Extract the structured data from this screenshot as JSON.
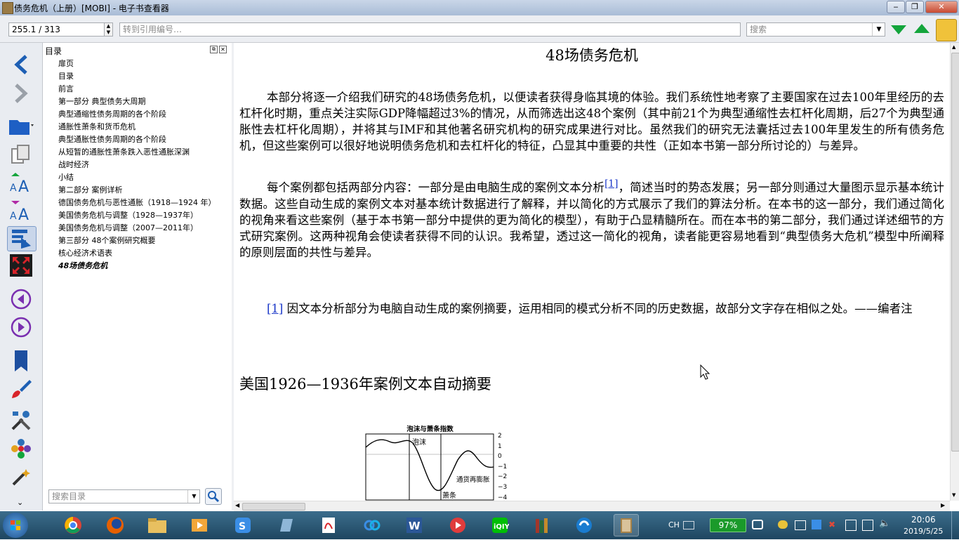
{
  "window": {
    "title": "债务危机（上册）[MOBI] - 电子书查看器"
  },
  "toolbar": {
    "position_value": "255.1 / 313",
    "goto_placeholder": "转到引用编号…",
    "search_placeholder": "搜索"
  },
  "toc": {
    "header": "目录",
    "items": [
      "扉页",
      "目录",
      "前言",
      "第一部分 典型债务大周期",
      "典型通缩性债务周期的各个阶段",
      "通胀性萧条和货币危机",
      "典型通胀性债务周期的各个阶段",
      "从短暂的通胀性萧条跌入恶性通胀深渊",
      "战时经济",
      "小结",
      "第二部分 案例详析",
      "德国债务危机与恶性通胀（1918—1924 年）",
      "美国债务危机与调整（1928—1937年）",
      "美国债务危机与调整（2007—2011年）",
      "第三部分 48个案例研究概要",
      "核心经济术语表",
      "48场债务危机"
    ],
    "search_placeholder": "搜索目录"
  },
  "reader": {
    "chapter_title": "48场债务危机",
    "para1": "本部分将逐一介绍我们研究的48场债务危机，以便读者获得身临其境的体验。我们系统性地考察了主要国家在过去100年里经历的去杠杆化时期，重点关注实际GDP降幅超过3%的情况，从而筛选出这48个案例（其中前21个为典型通缩性去杠杆化周期，后27个为典型通胀性去杠杆化周期），并将其与IMF和其他著名研究机构的研究成果进行对比。虽然我们的研究无法囊括过去100年里发生的所有债务危机，但这些案例可以很好地说明债务危机和去杠杆化的特征，凸显其中重要的共性（正如本书第一部分所讨论的）与差异。",
    "para2_before": "每个案例都包括两部分内容：一部分是由电脑生成的案例文本分析",
    "para2_ref": "[1]",
    "para2_after": "，简述当时的势态发展；另一部分则通过大量图示显示基本统计数据。这些自动生成的案例文本对基本统计数据进行了解释，并以简化的方式展示了我们的算法分析。在本书的这一部分，我们通过简化的视角来看这些案例（基于本书第一部分中提供的更为简化的模型），有助于凸显精髓所在。而在本书的第二部分，我们通过详述细节的方式研究案例。这两种视角会使读者获得不同的认识。我希望，透过这一简化的视角，读者能更容易地看到“典型债务大危机”模型中所阐释的原则层面的共性与差异。",
    "footnote_ref": "[1]",
    "footnote_text": "因文本分析部分为电脑自动生成的案例摘要，运用相同的模式分析不同的历史数据，故部分文字存在相似之处。——编者注",
    "section_title": "美国1926—1936年案例文本自动摘要",
    "figure": {
      "title": "泡沫与萧条指数",
      "label_bubble": "泡沫",
      "label_reflation": "通货再膨胀",
      "label_depression": "萧条",
      "ticks": [
        "2",
        "1",
        "0",
        "−1",
        "−2",
        "−3",
        "−4"
      ]
    }
  },
  "taskbar": {
    "lang": "CH",
    "battery": "97%",
    "time": "20:06",
    "date": "2019/5/25"
  }
}
